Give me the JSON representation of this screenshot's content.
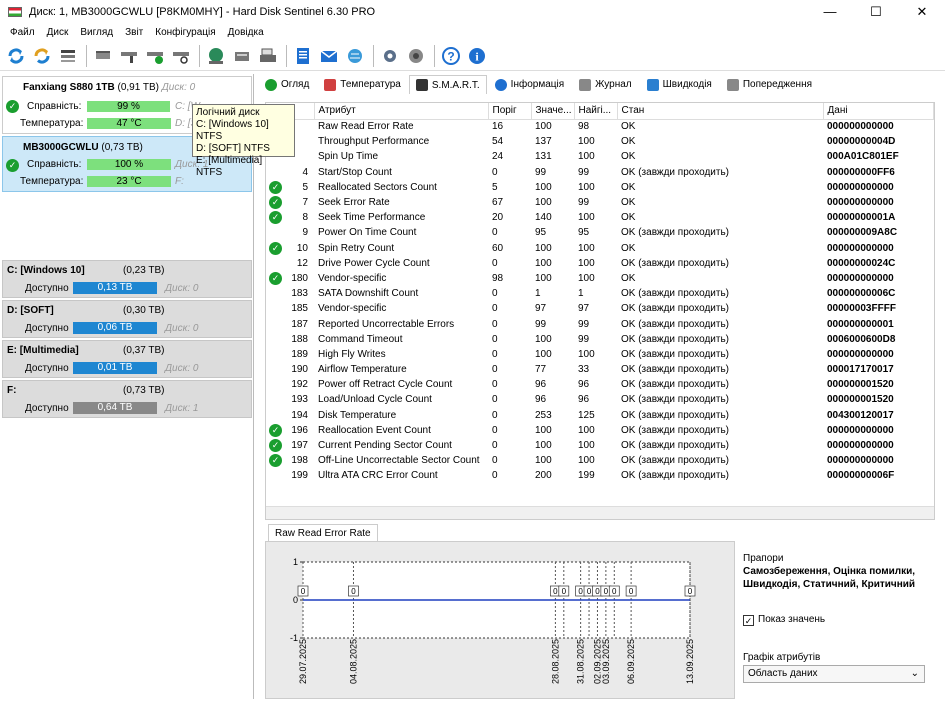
{
  "window": {
    "title": "Диск: 1, MB3000GCWLU [P8KM0MHY]  -  Hard Disk Sentinel 6.30 PRO",
    "minimize": "—",
    "maximize": "☐",
    "close": "✕"
  },
  "menu": [
    "Файл",
    "Диск",
    "Вигляд",
    "Звіт",
    "Конфігурація",
    "Довідка"
  ],
  "disks": [
    {
      "name": "Fanxiang S880 1TB",
      "size": "(0,91 TB)",
      "disk_no": "Диск: 0",
      "health_label": "Справність:",
      "health": "99 %",
      "health_frac": 0.99,
      "temp_label": "Температура:",
      "temp": "47 °C",
      "side_health": "C: [W",
      "side_temp": "D: [S"
    },
    {
      "name": "MB3000GCWLU",
      "size": "(0,73 TB)",
      "disk_no": "Диск: 1",
      "health_label": "Справність:",
      "health": "100 %",
      "health_frac": 1.0,
      "temp_label": "Температура:",
      "temp": "23 °C",
      "side_health": "",
      "side_temp": "F:"
    }
  ],
  "tooltip": {
    "title": "Логічний диск",
    "lines": [
      "C: [Windows 10] NTFS",
      "D: [SOFT] NTFS",
      "E: [Multimedia] NTFS"
    ]
  },
  "volumes": [
    {
      "name": "C: [Windows 10]",
      "size": "(0,23 TB)",
      "free_label": "Доступно",
      "free": "0,13 TB",
      "disk": "Диск: 0",
      "style": "blue"
    },
    {
      "name": "D: [SOFT]",
      "size": "(0,30 TB)",
      "free_label": "Доступно",
      "free": "0,06 TB",
      "disk": "Диск: 0",
      "style": "blue"
    },
    {
      "name": "E: [Multimedia]",
      "size": "(0,37 TB)",
      "free_label": "Доступно",
      "free": "0,01 TB",
      "disk": "Диск: 0",
      "style": "blue"
    },
    {
      "name": "F:",
      "size": "(0,73 TB)",
      "free_label": "Доступно",
      "free": "0,64 TB",
      "disk": "Диск: 1",
      "style": "gray"
    }
  ],
  "tabs": [
    {
      "label": "Огляд",
      "icon": "check-icon",
      "color": "#1a9e2f"
    },
    {
      "label": "Температура",
      "icon": "thermometer-icon",
      "color": "#d04040"
    },
    {
      "label": "S.M.A.R.T.",
      "icon": "disk-icon",
      "color": "#333333",
      "active": true
    },
    {
      "label": "Інформація",
      "icon": "info-icon",
      "color": "#1e6fd0"
    },
    {
      "label": "Журнал",
      "icon": "log-icon",
      "color": "#888888"
    },
    {
      "label": "Швидкодія",
      "icon": "speed-icon",
      "color": "#2a7fd0"
    },
    {
      "label": "Попередження",
      "icon": "alert-icon",
      "color": "#888888"
    }
  ],
  "smart": {
    "headers": [
      "",
      "Атрибут",
      "Поріг",
      "Значе...",
      "Найгі...",
      "Стан",
      "Дані"
    ],
    "rows": [
      {
        "id": "",
        "attr": "Raw Read Error Rate",
        "thr": "16",
        "val": "100",
        "worst": "98",
        "state": "OK",
        "data": "000000000000",
        "ok": false
      },
      {
        "id": "",
        "attr": "Throughput Performance",
        "thr": "54",
        "val": "137",
        "worst": "100",
        "state": "OK",
        "data": "00000000004D",
        "ok": false
      },
      {
        "id": "",
        "attr": "Spin Up Time",
        "thr": "24",
        "val": "131",
        "worst": "100",
        "state": "OK",
        "data": "000A01C801EF",
        "ok": false
      },
      {
        "id": "4",
        "attr": "Start/Stop Count",
        "thr": "0",
        "val": "99",
        "worst": "99",
        "state": "OK (завжди проходить)",
        "data": "000000000FF6",
        "ok": false
      },
      {
        "id": "5",
        "attr": "Reallocated Sectors Count",
        "thr": "5",
        "val": "100",
        "worst": "100",
        "state": "OK",
        "data": "000000000000",
        "ok": true
      },
      {
        "id": "7",
        "attr": "Seek Error Rate",
        "thr": "67",
        "val": "100",
        "worst": "99",
        "state": "OK",
        "data": "000000000000",
        "ok": true
      },
      {
        "id": "8",
        "attr": "Seek Time Performance",
        "thr": "20",
        "val": "140",
        "worst": "100",
        "state": "OK",
        "data": "00000000001A",
        "ok": true
      },
      {
        "id": "9",
        "attr": "Power On Time Count",
        "thr": "0",
        "val": "95",
        "worst": "95",
        "state": "OK (завжди проходить)",
        "data": "000000009A8C",
        "ok": false
      },
      {
        "id": "10",
        "attr": "Spin Retry Count",
        "thr": "60",
        "val": "100",
        "worst": "100",
        "state": "OK",
        "data": "000000000000",
        "ok": true
      },
      {
        "id": "12",
        "attr": "Drive Power Cycle Count",
        "thr": "0",
        "val": "100",
        "worst": "100",
        "state": "OK (завжди проходить)",
        "data": "00000000024C",
        "ok": false
      },
      {
        "id": "180",
        "attr": "Vendor-specific",
        "thr": "98",
        "val": "100",
        "worst": "100",
        "state": "OK",
        "data": "000000000000",
        "ok": true
      },
      {
        "id": "183",
        "attr": "SATA Downshift Count",
        "thr": "0",
        "val": "1",
        "worst": "1",
        "state": "OK (завжди проходить)",
        "data": "00000000006C",
        "ok": false
      },
      {
        "id": "185",
        "attr": "Vendor-specific",
        "thr": "0",
        "val": "97",
        "worst": "97",
        "state": "OK (завжди проходить)",
        "data": "00000003FFFF",
        "ok": false
      },
      {
        "id": "187",
        "attr": "Reported Uncorrectable Errors",
        "thr": "0",
        "val": "99",
        "worst": "99",
        "state": "OK (завжди проходить)",
        "data": "000000000001",
        "ok": false
      },
      {
        "id": "188",
        "attr": "Command Timeout",
        "thr": "0",
        "val": "100",
        "worst": "99",
        "state": "OK (завжди проходить)",
        "data": "0006000600D8",
        "ok": false
      },
      {
        "id": "189",
        "attr": "High Fly Writes",
        "thr": "0",
        "val": "100",
        "worst": "100",
        "state": "OK (завжди проходить)",
        "data": "000000000000",
        "ok": false
      },
      {
        "id": "190",
        "attr": "Airflow Temperature",
        "thr": "0",
        "val": "77",
        "worst": "33",
        "state": "OK (завжди проходить)",
        "data": "000017170017",
        "ok": false
      },
      {
        "id": "192",
        "attr": "Power off Retract Cycle Count",
        "thr": "0",
        "val": "96",
        "worst": "96",
        "state": "OK (завжди проходить)",
        "data": "000000001520",
        "ok": false
      },
      {
        "id": "193",
        "attr": "Load/Unload Cycle Count",
        "thr": "0",
        "val": "96",
        "worst": "96",
        "state": "OK (завжди проходить)",
        "data": "000000001520",
        "ok": false
      },
      {
        "id": "194",
        "attr": "Disk Temperature",
        "thr": "0",
        "val": "253",
        "worst": "125",
        "state": "OK (завжди проходить)",
        "data": "004300120017",
        "ok": false
      },
      {
        "id": "196",
        "attr": "Reallocation Event Count",
        "thr": "0",
        "val": "100",
        "worst": "100",
        "state": "OK (завжди проходить)",
        "data": "000000000000",
        "ok": true
      },
      {
        "id": "197",
        "attr": "Current Pending Sector Count",
        "thr": "0",
        "val": "100",
        "worst": "100",
        "state": "OK (завжди проходить)",
        "data": "000000000000",
        "ok": true
      },
      {
        "id": "198",
        "attr": "Off-Line Uncorrectable Sector Count",
        "thr": "0",
        "val": "100",
        "worst": "100",
        "state": "OK (завжди проходить)",
        "data": "000000000000",
        "ok": true
      },
      {
        "id": "199",
        "attr": "Ultra ATA CRC Error Count",
        "thr": "0",
        "val": "200",
        "worst": "199",
        "state": "OK (завжди проходить)",
        "data": "00000000006F",
        "ok": false
      }
    ]
  },
  "graph": {
    "tab_label": "Raw Read Error Rate",
    "flags_label": "Прапори",
    "flags_value_1": "Самозбереження, Оцінка помилки,",
    "flags_value_2": "Швидкодія, Статичний, Критичний",
    "show_values_label": "Показ значень",
    "show_values_checked": true,
    "attr_graph_label": "Графік атрибутів",
    "attr_graph_select": "Область даних"
  },
  "chart_data": {
    "type": "line",
    "x": [
      "29.07.2025",
      "04.08.2025",
      "28.08.2025",
      "29.08.2025",
      "31.08.2025",
      "01.09.2025",
      "02.09.2025",
      "03.09.2025",
      "04.09.2025",
      "06.09.2025",
      "13.09.2025"
    ],
    "x_tick_labels": [
      "29.07.2025",
      "04.08.2025",
      "28.08.2025",
      "31.08.2025",
      "02.09.2025",
      "03.09.2025",
      "06.09.2025",
      "13.09.2025"
    ],
    "values": [
      0,
      0,
      0,
      0,
      0,
      0,
      0,
      0,
      0,
      0,
      0
    ],
    "data_labels": [
      "0",
      "0",
      "0",
      "0",
      "0",
      "0",
      "0",
      "0",
      "0",
      "0",
      "0"
    ],
    "y_ticks": [
      "1",
      "0",
      "-1"
    ],
    "ylim": [
      -1,
      1
    ],
    "color": "#1f3fbf"
  }
}
